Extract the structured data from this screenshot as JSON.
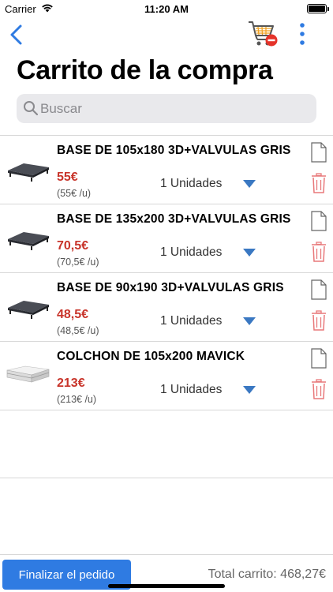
{
  "status": {
    "carrier": "Carrier",
    "time": "11:20 AM"
  },
  "nav": {
    "title": "Carrito de la compra",
    "search_placeholder": "Buscar",
    "icons": [
      "chevron-left-icon",
      "cart-remove-icon",
      "more-vertical-icon"
    ]
  },
  "items": [
    {
      "name": "BASE DE 105x180 3D+VALVULAS GRIS",
      "price": "55€",
      "unit_price": "(55€ /u)",
      "qty": "1 Unidades",
      "thumb": "base"
    },
    {
      "name": "BASE DE 135x200 3D+VALVULAS GRIS",
      "price": "70,5€",
      "unit_price": "(70,5€ /u)",
      "qty": "1 Unidades",
      "thumb": "base"
    },
    {
      "name": "BASE DE 90x190 3D+VALVULAS GRIS",
      "price": "48,5€",
      "unit_price": "(48,5€ /u)",
      "qty": "1 Unidades",
      "thumb": "base"
    },
    {
      "name": "COLCHON DE 105x200 MAVICK",
      "price": "213€",
      "unit_price": "(213€ /u)",
      "qty": "1 Unidades",
      "thumb": "mattress"
    }
  ],
  "footer": {
    "checkout_label": "Finalizar el pedido",
    "total": "Total carrito: 468,27€"
  },
  "colors": {
    "accent": "#2f7be2",
    "price": "#c8342a",
    "trash": "#e8787a",
    "caret": "#3a78c2",
    "cart_badge": "#e5332a"
  }
}
